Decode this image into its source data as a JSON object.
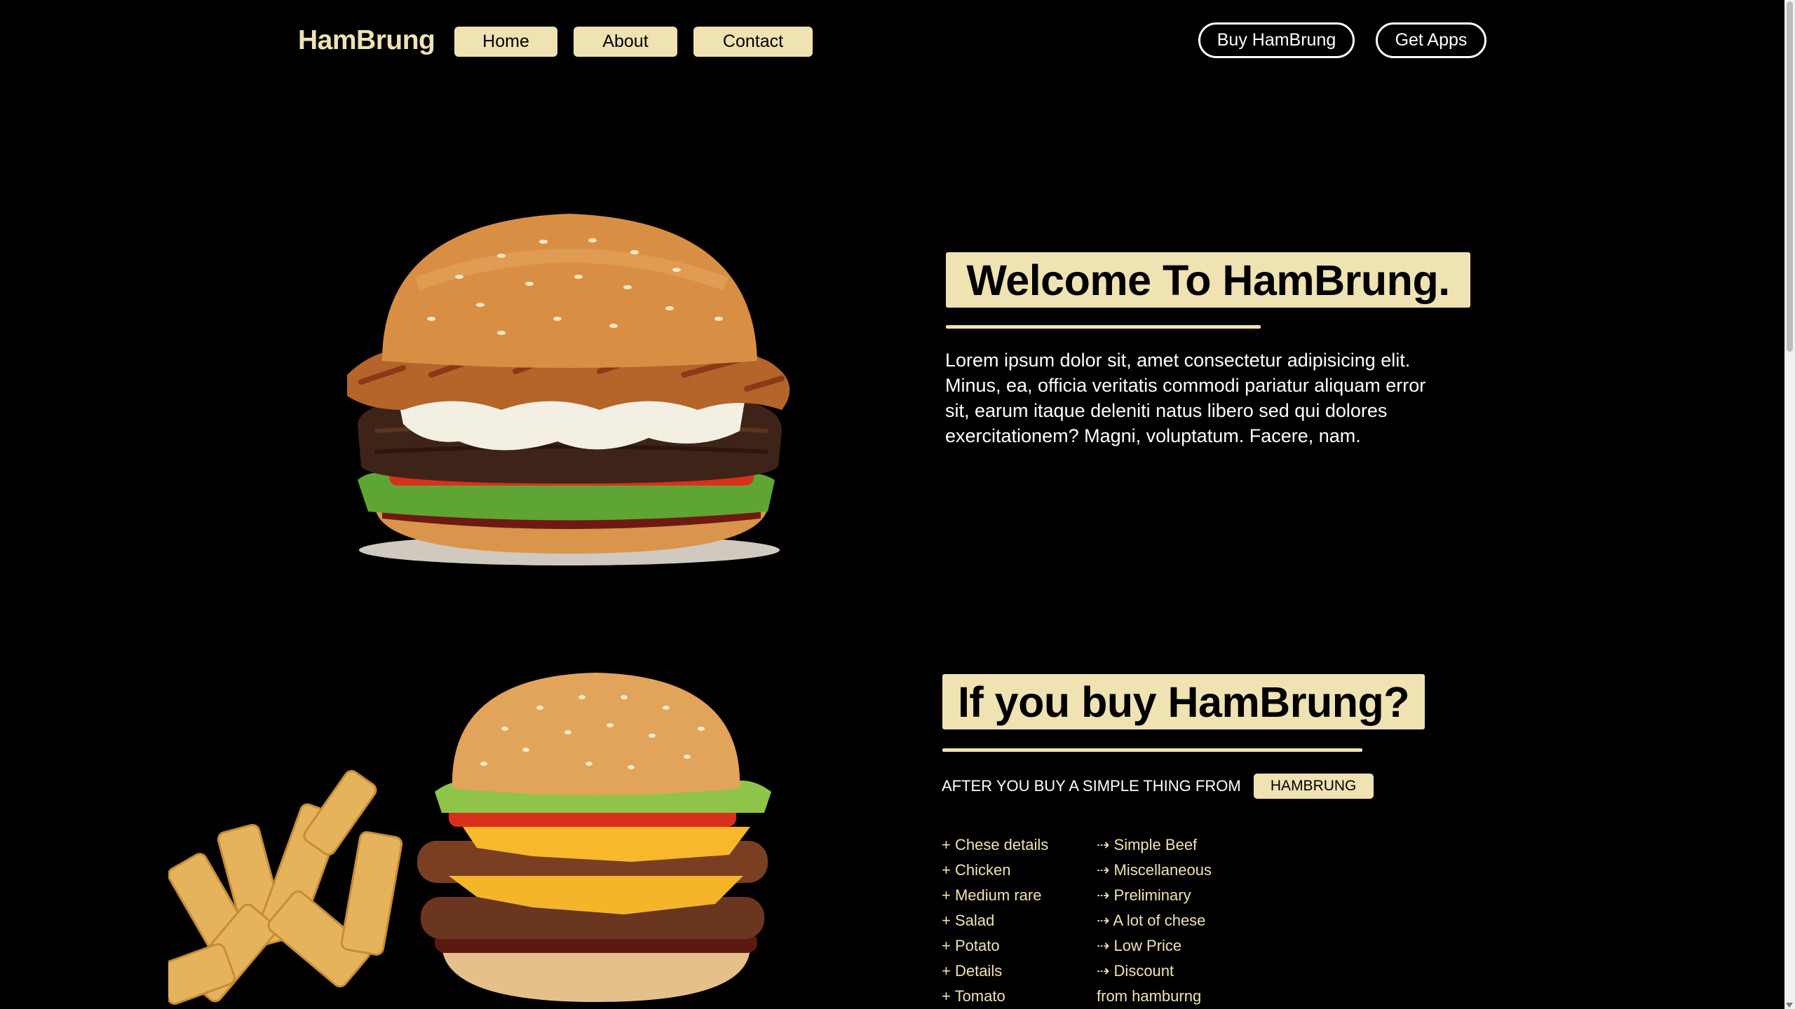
{
  "header": {
    "logo": "HamBrung",
    "nav": [
      {
        "label": "Home"
      },
      {
        "label": "About"
      },
      {
        "label": "Contact"
      }
    ],
    "buy_button": "Buy HamBrung",
    "apps_button": "Get Apps"
  },
  "welcome": {
    "title": "Welcome To HamBrung.",
    "text": "Lorem ipsum dolor sit, amet consectetur adipisicing elit. Minus, ea, officia veritatis commodi pariatur aliquam error sit, earum itaque deleniti natus libero sed qui dolores exercitationem? Magni, voluptatum. Facere, nam."
  },
  "buy": {
    "title": "If you buy HamBrung?",
    "after_text": "AFTER YOU BUY A SIMPLE THING FROM",
    "badge": "HAMBRUNG",
    "left_list": [
      "+ Chese details",
      "+ Chicken",
      "+ Medium rare",
      "+ Salad",
      "+ Potato",
      "+ Details",
      "+ Tomato"
    ],
    "right_list": [
      "⇢ Simple Beef",
      "⇢ Miscellaneous",
      "⇢ Preliminary",
      "⇢ A lot of chese",
      "⇢ Low Price",
      "⇢ Discount",
      "from hamburng"
    ]
  },
  "colors": {
    "accent": "#efe2b3",
    "background": "#000000",
    "text": "#ffffff"
  }
}
